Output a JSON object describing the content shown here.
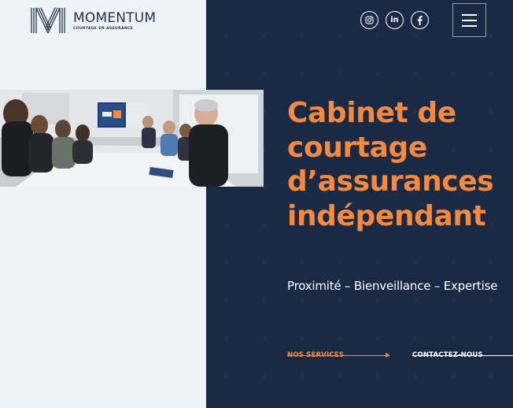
{
  "brand": {
    "name": "MOMENTUM",
    "tagline": "COURTAGE EN ASSURANCE",
    "logo_icon": "m-monogram-logo"
  },
  "header": {
    "social": [
      {
        "name": "instagram",
        "icon": "instagram-icon"
      },
      {
        "name": "linkedin",
        "icon": "linkedin-icon",
        "glyph": "in"
      },
      {
        "name": "facebook",
        "icon": "facebook-icon"
      }
    ],
    "menu_icon": "hamburger-menu-icon"
  },
  "hero": {
    "title_lines": [
      "Cabinet de",
      "courtage",
      "d’assurances",
      "indépendant"
    ],
    "subtitle": "Proximité – Bienveillance – Expertise",
    "photo": "meeting-room-photo"
  },
  "cta": {
    "services_label": "NOS SERVICES",
    "contact_label": "CONTACTEZ-NOUS"
  },
  "colors": {
    "navy": "#1b2a44",
    "accent_orange": "#f5893f",
    "light_background": "#eef3f8",
    "logo_text": "#23324f"
  }
}
